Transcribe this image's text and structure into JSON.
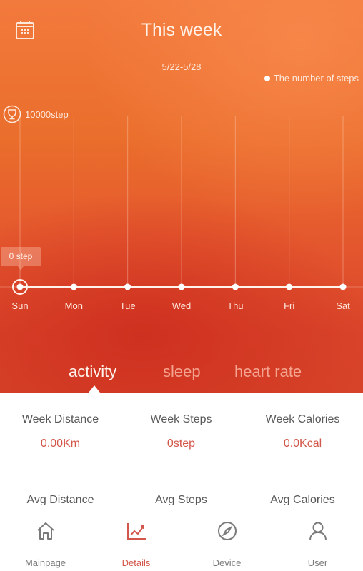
{
  "header": {
    "title": "This week",
    "date_range": "5/22-5/28",
    "legend_label": "The number of steps",
    "calendar_icon": "calendar-icon"
  },
  "goal": {
    "icon": "trophy-icon",
    "label": "10000step"
  },
  "chart_data": {
    "type": "line",
    "title": "This week",
    "subtitle": "5/22-5/28",
    "categories": [
      "Sun",
      "Mon",
      "Tue",
      "Wed",
      "Thu",
      "Fri",
      "Sat"
    ],
    "series": [
      {
        "name": "The number of steps",
        "values": [
          0,
          0,
          0,
          0,
          0,
          0,
          0
        ]
      }
    ],
    "goal_line": {
      "value": 10000,
      "label": "10000step"
    },
    "ylim": [
      0,
      10000
    ],
    "selected_index": 0,
    "tooltip": "0 step",
    "legend": "top-right",
    "grid": true
  },
  "tabs": [
    {
      "label": "activity",
      "active": true
    },
    {
      "label": "sleep",
      "active": false
    },
    {
      "label": "heart rate",
      "active": false
    }
  ],
  "stats": {
    "week": [
      {
        "label": "Week Distance",
        "value": "0.00Km"
      },
      {
        "label": "Week Steps",
        "value": "0step"
      },
      {
        "label": "Week Calories",
        "value": "0.0Kcal"
      }
    ],
    "avg": [
      {
        "label": "Avg Distance"
      },
      {
        "label": "Avg Steps"
      },
      {
        "label": "Avg Calories"
      }
    ]
  },
  "bottom_nav": [
    {
      "label": "Mainpage",
      "icon": "home-icon",
      "active": false
    },
    {
      "label": "Details",
      "icon": "chart-icon",
      "active": true
    },
    {
      "label": "Device",
      "icon": "compass-icon",
      "active": false
    },
    {
      "label": "User",
      "icon": "user-icon",
      "active": false
    }
  ],
  "colors": {
    "accent": "#d3564a",
    "hero_top": "#f27a3c",
    "hero_bottom": "#d64328"
  }
}
